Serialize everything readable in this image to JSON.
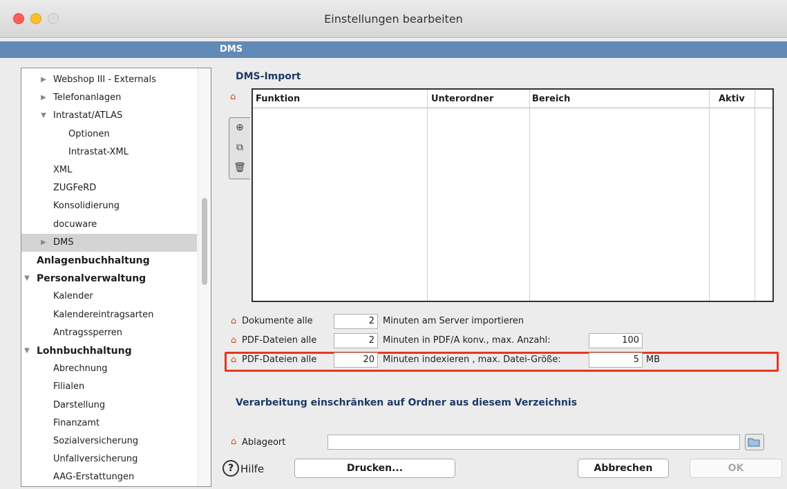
{
  "window": {
    "title": "Einstellungen bearbeiten"
  },
  "section": {
    "title": "DMS"
  },
  "sidebar": {
    "items": [
      {
        "label": "Webshop III - Externals",
        "expand": "collapsed",
        "level": 1
      },
      {
        "label": "Telefonanlagen",
        "expand": "collapsed",
        "level": 1
      },
      {
        "label": "Intrastat/ATLAS",
        "expand": "expanded",
        "level": 1
      },
      {
        "label": "Optionen",
        "expand": "none",
        "level": 2
      },
      {
        "label": "Intrastat-XML",
        "expand": "none",
        "level": 2
      },
      {
        "label": "XML",
        "expand": "none",
        "level": 1
      },
      {
        "label": "ZUGFeRD",
        "expand": "none",
        "level": 1
      },
      {
        "label": "Konsolidierung",
        "expand": "none",
        "level": 1
      },
      {
        "label": "docuware",
        "expand": "none",
        "level": 1
      },
      {
        "label": "DMS",
        "expand": "collapsed",
        "level": 1,
        "selected": true
      },
      {
        "label": "Anlagenbuchhaltung",
        "expand": "none",
        "level": 0,
        "bold": true
      },
      {
        "label": "Personalverwaltung",
        "expand": "expanded",
        "level": 0,
        "bold": true
      },
      {
        "label": "Kalender",
        "expand": "none",
        "level": 1
      },
      {
        "label": "Kalendereintragsarten",
        "expand": "none",
        "level": 1
      },
      {
        "label": "Antragssperren",
        "expand": "none",
        "level": 1
      },
      {
        "label": "Lohnbuchhaltung",
        "expand": "expanded",
        "level": 0,
        "bold": true
      },
      {
        "label": "Abrechnung",
        "expand": "none",
        "level": 1
      },
      {
        "label": "Filialen",
        "expand": "none",
        "level": 1
      },
      {
        "label": "Darstellung",
        "expand": "none",
        "level": 1
      },
      {
        "label": "Finanzamt",
        "expand": "none",
        "level": 1
      },
      {
        "label": "Sozialversicherung",
        "expand": "none",
        "level": 1
      },
      {
        "label": "Unfallversicherung",
        "expand": "none",
        "level": 1
      },
      {
        "label": "AAG-Erstattungen",
        "expand": "none",
        "level": 1
      }
    ]
  },
  "import": {
    "heading": "DMS-Import",
    "columns": [
      "Funktion",
      "Unterordner",
      "Bereich",
      "Aktiv"
    ],
    "rows": [],
    "tools": [
      "add-document-icon",
      "duplicate-document-icon",
      "trash-icon"
    ]
  },
  "settings": {
    "row1": {
      "label": "Dokumente alle",
      "value": "2",
      "suffix": "Minuten am Server importieren"
    },
    "row2": {
      "label": "PDF-Dateien alle",
      "value": "2",
      "suffix": "Minuten in PDF/A konv., max. Anzahl:",
      "value2": "100"
    },
    "row3": {
      "label": "PDF-Dateien alle",
      "value": "20",
      "suffix": "Minuten indexieren , max. Datei-Größe:",
      "value2": "5",
      "unit": "MB"
    }
  },
  "restrict": {
    "heading": "Verarbeitung einschränken auf Ordner aus diesem Verzeichnis",
    "ablage_label": "Ablageort",
    "ablage_value": ""
  },
  "footer": {
    "help": "Hilfe",
    "print": "Drucken...",
    "cancel": "Abbrechen",
    "ok": "OK"
  },
  "colors": {
    "section_bar": "#628ab6",
    "highlight": "#e8361f",
    "heading": "#1d3a66"
  }
}
